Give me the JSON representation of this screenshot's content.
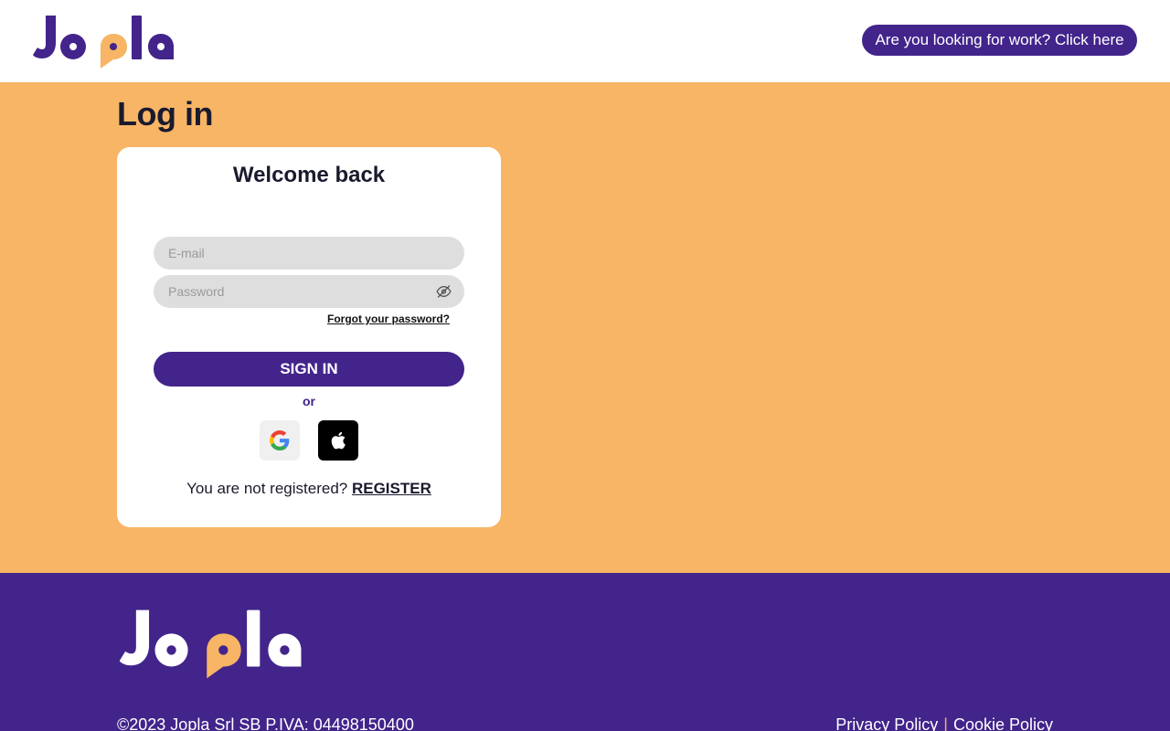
{
  "brand": {
    "name": "Jopla",
    "primary_color": "#42248b",
    "accent_color": "#f7b565"
  },
  "header": {
    "work_button_label": "Are you looking for work? Click here"
  },
  "main": {
    "page_title": "Log in",
    "card": {
      "title": "Welcome back",
      "email_placeholder": "E-mail",
      "email_value": "",
      "password_placeholder": "Password",
      "password_value": "",
      "password_toggle_icon": "eye-off-icon",
      "forgot_password_label": "Forgot your password?",
      "sign_in_label": "SIGN IN",
      "or_label": "or",
      "social_buttons": [
        {
          "name": "google",
          "icon": "google-icon"
        },
        {
          "name": "apple",
          "icon": "apple-icon"
        }
      ],
      "not_registered_text": "You are not registered?",
      "register_label": "REGISTER"
    }
  },
  "footer": {
    "copyright": "©2023 Jopla Srl SB P.IVA: 04498150400",
    "privacy_label": "Privacy Policy",
    "separator": "|",
    "cookie_label": "Cookie Policy"
  }
}
